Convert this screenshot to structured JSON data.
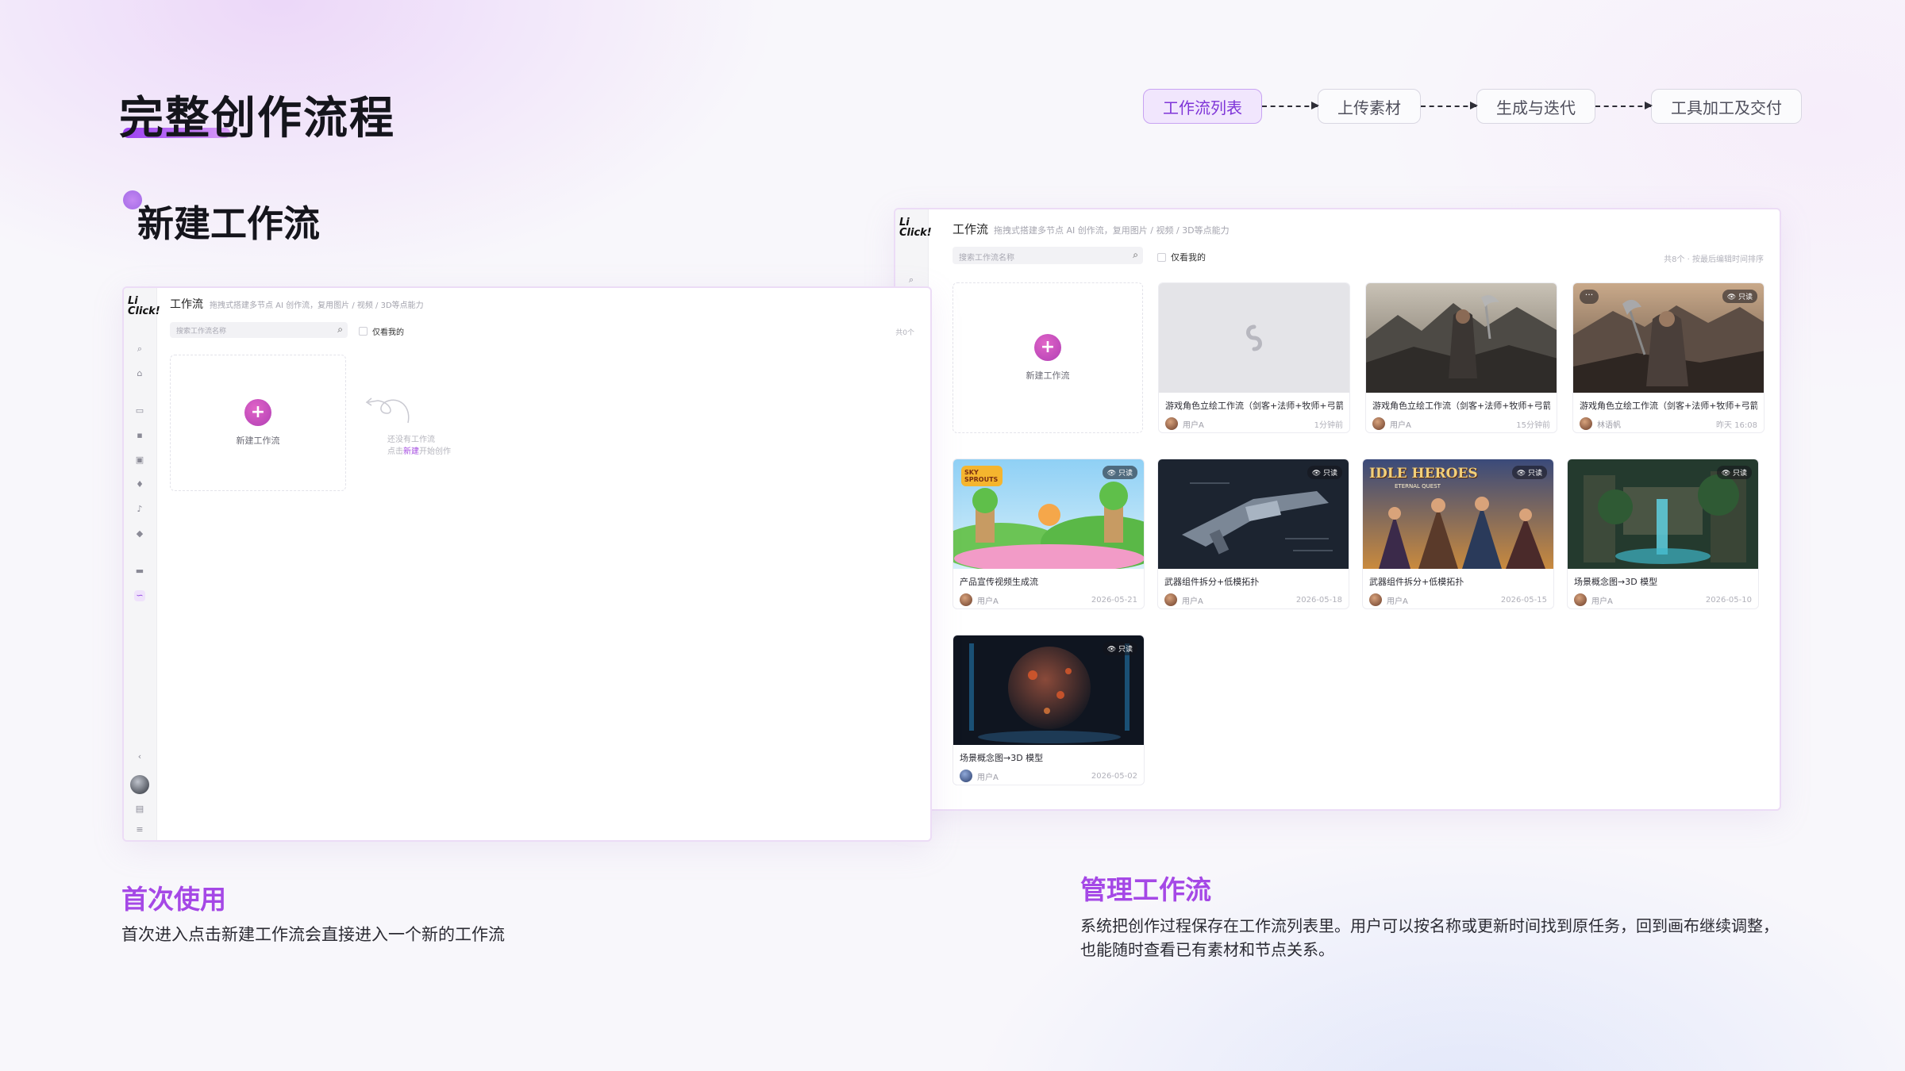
{
  "page": {
    "title": "完整创作流程",
    "section_title": "新建工作流"
  },
  "flow": {
    "steps": [
      {
        "label": "工作流列表",
        "active": true
      },
      {
        "label": "上传素材",
        "active": false
      },
      {
        "label": "生成与迭代",
        "active": false
      },
      {
        "label": "工具加工及交付",
        "active": false
      }
    ]
  },
  "left_window": {
    "logo": "Li Click!",
    "title": "工作流",
    "subtitle": "拖拽式搭建多节点 AI 创作流，复用图片 / 视频 / 3D等点能力",
    "search_placeholder": "搜索工作流名称",
    "only_mine": "仅看我的",
    "count": "共0个",
    "new_label": "新建工作流",
    "hint_line1": "还没有工作流",
    "hint_prefix": "点击",
    "hint_link": "新建",
    "hint_suffix": "开始创作"
  },
  "right_window": {
    "logo": "Li Click!",
    "title": "工作流",
    "subtitle": "拖拽式搭建多节点 AI 创作流，复用图片 / 视频 / 3D等点能力",
    "search_placeholder": "搜索工作流名称",
    "only_mine": "仅看我的",
    "count": "共8个 · 按最后编辑时间排序",
    "new_label": "新建工作流",
    "cards": [
      {
        "title": "游戏角色立绘工作流（剑客+法师+牧师+弓箭...",
        "user": "用户A",
        "time": "1分钟前",
        "badge": ""
      },
      {
        "title": "游戏角色立绘工作流（剑客+法师+牧师+弓箭...",
        "user": "用户A",
        "time": "15分钟前",
        "badge": ""
      },
      {
        "title": "游戏角色立绘工作流（剑客+法师+牧师+弓箭...",
        "user": "林语帆",
        "time": "昨天 16:08",
        "badge": "只读"
      },
      {
        "title": "产品宣传视频生成流",
        "user": "用户A",
        "time": "2026-05-21",
        "badge": "只读"
      },
      {
        "title": "武器组件拆分+低模拓扑",
        "user": "用户A",
        "time": "2026-05-18",
        "badge": "只读"
      },
      {
        "title": "武器组件拆分+低模拓扑",
        "user": "用户A",
        "time": "2026-05-15",
        "badge": "只读"
      },
      {
        "title": "场景概念图→3D 模型",
        "user": "用户A",
        "time": "2026-05-10",
        "badge": "只读"
      },
      {
        "title": "场景概念图→3D 模型",
        "user": "用户A",
        "time": "2026-05-02",
        "badge": "只读"
      }
    ],
    "thumb_texts": {
      "sky": "SKY SPROUTS",
      "idle": "IDLE HEROES",
      "idle_sub": "ETERNAL QUEST"
    }
  },
  "captions": {
    "first_use_title": "首次使用",
    "first_use_text": "首次进入点击新建工作流会直接进入一个新的工作流",
    "manage_title": "管理工作流",
    "manage_text_1": "系统把创作过程保存在工作流列表里。用户可以按名称或更新时间找到原任务，回到画布继续调整，",
    "manage_text_2": "也能随时查看已有素材和节点关系。"
  },
  "colors": {
    "accent": "#a548e6",
    "step_active_bg": "#f1e6fd",
    "plus_button": "#c84dbd"
  }
}
